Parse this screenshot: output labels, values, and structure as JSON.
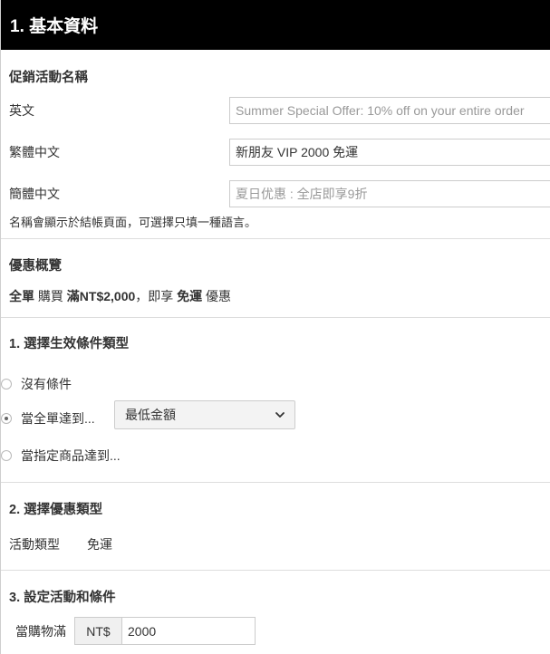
{
  "header": {
    "title": "1. 基本資料"
  },
  "names": {
    "title": "促銷活動名稱",
    "rows": [
      {
        "label": "英文",
        "value": "",
        "placeholder": "Summer Special Offer: 10% off on your entire order"
      },
      {
        "label": "繁體中文",
        "value": "新朋友 VIP 2000 免運",
        "placeholder": ""
      },
      {
        "label": "簡體中文",
        "value": "",
        "placeholder": "夏日优惠 : 全店即享9折"
      }
    ],
    "hint": "名稱會顯示於結帳頁面，可選擇只填一種語言。"
  },
  "summary": {
    "title": "優惠概覽",
    "parts": [
      "全單",
      "購買",
      "滿NT$2,000",
      "，即享",
      "免運",
      "優惠"
    ]
  },
  "condition": {
    "title": "1. 選擇生效條件類型",
    "options": [
      {
        "label": "沒有條件",
        "checked": false
      },
      {
        "label": "當全單達到...",
        "checked": true
      },
      {
        "label": "當指定商品達到...",
        "checked": false
      }
    ],
    "select_value": "最低金額"
  },
  "discount": {
    "title": "2. 選擇優惠類型",
    "label": "活動類型",
    "value": "免運"
  },
  "activity": {
    "title": "3. 設定活動和條件",
    "threshold_label": "當購物滿",
    "currency": "NT$",
    "amount": "2000"
  },
  "icons": {
    "select_chevron": "chevron-down-icon"
  },
  "colors": {
    "header_bg": "#000000",
    "header_text": "#ffffff",
    "border": "#dddddd"
  }
}
